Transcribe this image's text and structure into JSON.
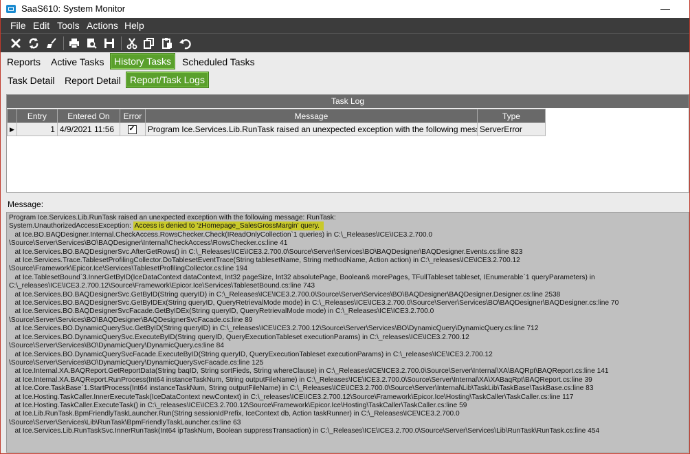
{
  "window": {
    "title": "SaaS610: System Monitor",
    "minimize_glyph": "—"
  },
  "menu": [
    "File",
    "Edit",
    "Tools",
    "Actions",
    "Help"
  ],
  "toolbar_icons": [
    "close-icon",
    "refresh-icon",
    "clear-icon",
    "print-icon",
    "print-preview-icon",
    "save-icon",
    "cut-icon",
    "copy-icon",
    "paste-icon",
    "undo-icon"
  ],
  "main_tabs": [
    "Reports",
    "Active Tasks",
    "History Tasks",
    "Scheduled Tasks"
  ],
  "sub_tabs": [
    "Task Detail",
    "Report Detail",
    "Report/Task Logs"
  ],
  "task_log": {
    "title": "Task Log",
    "columns": [
      "Entry",
      "Entered On",
      "Error",
      "Message",
      "Type"
    ],
    "rows": [
      {
        "indicator": "▶",
        "entry": "1",
        "entered_on": "4/9/2021 11:56",
        "error": true,
        "message": "Program Ice.Services.Lib.RunTask raised an unexpected exception with the following message",
        "type": "ServerError"
      }
    ]
  },
  "message": {
    "label": "Message:",
    "line1": "Program Ice.Services.Lib.RunTask raised an unexpected exception with the following message: RunTask:",
    "line2_prefix": "System.UnauthorizedAccessException: ",
    "line2_highlight": "Access is denied to 'zHomepage_SalesGrossMargin' query.",
    "lines": [
      "   at Ice.BO.BAQDesigner.Internal.CheckAccess.RowsChecker.Check(IReadOnlyCollection`1 queries) in C:\\_Releases\\ICE\\ICE3.2.700.0",
      "\\Source\\Server\\Services\\BO\\BAQDesigner\\Internal\\CheckAccess\\RowsChecker.cs:line 41",
      "   at Ice.Services.BO.BAQDesignerSvc.AfterGetRows() in C:\\_Releases\\ICE\\ICE3.2.700.0\\Source\\Server\\Services\\BO\\BAQDesigner\\BAQDesigner.Events.cs:line 823",
      "   at Ice.Services.Trace.TablesetProfilingCollector.DoTablesetEventTrace(String tablesetName, String methodName, Action action) in C:\\_releases\\ICE\\ICE3.2.700.12",
      "\\Source\\Framework\\Epicor.Ice\\Services\\TablesetProfilingCollector.cs:line 194",
      "   at Ice.TablesetBound`3.InnerGetByID(IceDataContext dataContext, Int32 pageSize, Int32 absolutePage, Boolean& morePages, TFullTableset tableset, IEnumerable`1 queryParameters) in",
      "C:\\_releases\\ICE\\ICE3.2.700.12\\Source\\Framework\\Epicor.Ice\\Services\\TablesetBound.cs:line 743",
      "   at Ice.Services.BO.BAQDesignerSvc.GetByID(String queryID) in C:\\_Releases\\ICE\\ICE3.2.700.0\\Source\\Server\\Services\\BO\\BAQDesigner\\BAQDesigner.Designer.cs:line 2538",
      "   at Ice.Services.BO.BAQDesignerSvc.GetByIDEx(String queryID, QueryRetrievalMode mode) in C:\\_Releases\\ICE\\ICE3.2.700.0\\Source\\Server\\Services\\BO\\BAQDesigner\\BAQDesigner.cs:line 70",
      "   at Ice.Services.BO.BAQDesignerSvcFacade.GetByIDEx(String queryID, QueryRetrievalMode mode) in C:\\_Releases\\ICE\\ICE3.2.700.0",
      "\\Source\\Server\\Services\\BO\\BAQDesigner\\BAQDesignerSvcFacade.cs:line 89",
      "   at Ice.Services.BO.DynamicQuerySvc.GetByID(String queryID) in C:\\_releases\\ICE\\ICE3.2.700.12\\Source\\Server\\Services\\BO\\DynamicQuery\\DynamicQuery.cs:line 712",
      "   at Ice.Services.BO.DynamicQuerySvc.ExecuteByID(String queryID, QueryExecutionTableset executionParams) in C:\\_releases\\ICE\\ICE3.2.700.12",
      "\\Source\\Server\\Services\\BO\\DynamicQuery\\DynamicQuery.cs:line 84",
      "   at Ice.Services.BO.DynamicQuerySvcFacade.ExecuteByID(String queryID, QueryExecutionTableset executionParams) in C:\\_releases\\ICE\\ICE3.2.700.12",
      "\\Source\\Server\\Services\\BO\\DynamicQuery\\DynamicQuerySvcFacade.cs:line 125",
      "   at Ice.Internal.XA.BAQReport.GetReportData(String baqID, String sortFieds, String whereClause) in C:\\_Releases\\ICE\\ICE3.2.700.0\\Source\\Server\\Internal\\XA\\BAQRpt\\BAQReport.cs:line 141",
      "   at Ice.Internal.XA.BAQReport.RunProcess(Int64 instanceTaskNum, String outputFileName) in C:\\_Releases\\ICE\\ICE3.2.700.0\\Source\\Server\\Internal\\XA\\XABaqRpt\\BAQReport.cs:line 39",
      "   at Ice.Core.TaskBase`1.StartProcess(Int64 instanceTaskNum, String outputFileName) in C:\\_Releases\\ICE\\ICE3.2.700.0\\Source\\Server\\Internal\\Lib\\TaskLib\\TaskBase\\TaskBase.cs:line 83",
      "   at Ice.Hosting.TaskCaller.InnerExecuteTask(IceDataContext newContext) in C:\\_releases\\ICE\\ICE3.2.700.12\\Source\\Framework\\Epicor.Ice\\Hosting\\TaskCaller\\TaskCaller.cs:line 117",
      "   at Ice.Hosting.TaskCaller.ExecuteTask() in C:\\_releases\\ICE\\ICE3.2.700.12\\Source\\Framework\\Epicor.Ice\\Hosting\\TaskCaller\\TaskCaller.cs:line 59",
      "   at Ice.Lib.RunTask.BpmFriendlyTaskLauncher.Run(String sessionIdPrefix, IceContext db, Action taskRunner) in C:\\_Releases\\ICE\\ICE3.2.700.0",
      "\\Source\\Server\\Services\\Lib\\RunTask\\BpmFriendlyTaskLauncher.cs:line 63",
      "   at Ice.Services.Lib.RunTaskSvc.InnerRunTask(Int64 ipTaskNum, Boolean suppressTransaction) in C:\\_Releases\\ICE\\ICE3.2.700.0\\Source\\Server\\Services\\Lib\\RunTask\\RunTask.cs:line 454"
    ]
  },
  "colors": {
    "menubar": "#3c3c3c",
    "active_tab": "#5aa02c",
    "grid_header": "#696969",
    "highlight": "#c9c92a",
    "message_bg": "#c0c0c0"
  }
}
